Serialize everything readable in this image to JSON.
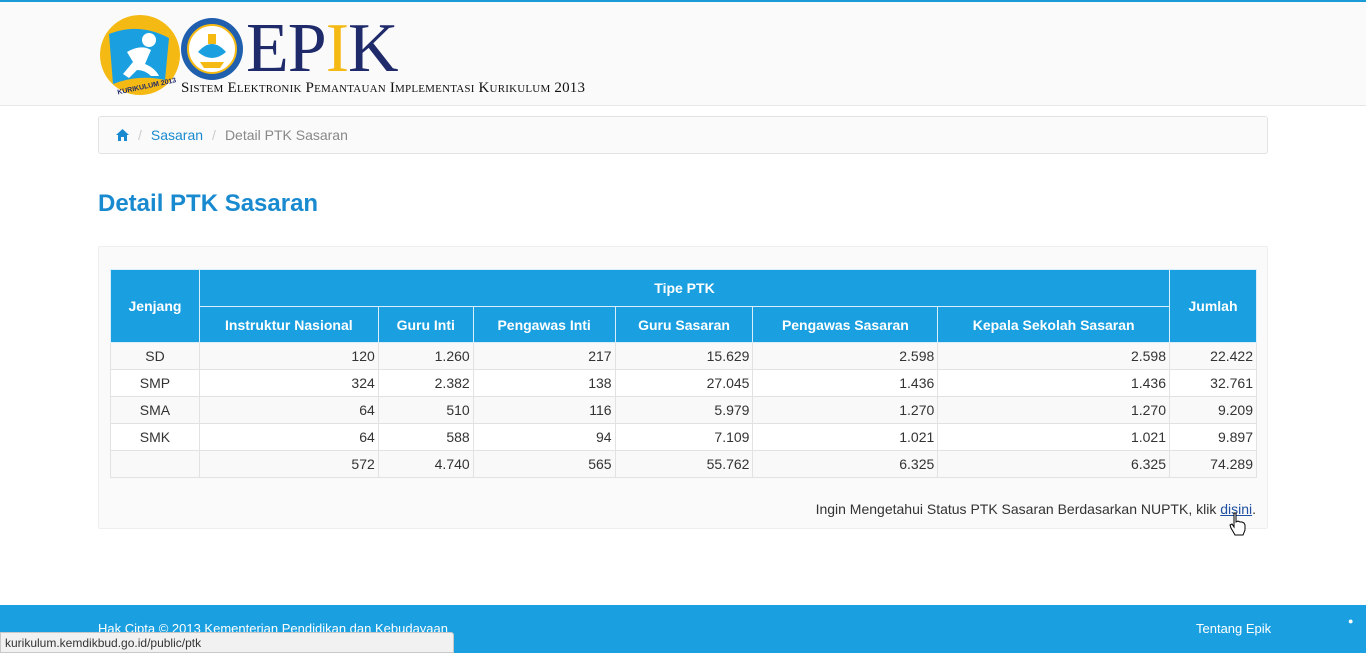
{
  "header": {
    "logo_text_a": "EP",
    "logo_text_i": "I",
    "logo_text_b": "K",
    "subtitle": "Sistem Elektronik Pemantauan Implementasi Kurikulum 2013",
    "badge_text": "KURIKULUM 2013"
  },
  "breadcrumb": {
    "home_icon": "home-icon",
    "items": [
      "Sasaran",
      "Detail PTK Sasaran"
    ]
  },
  "page_title": "Detail PTK Sasaran",
  "table": {
    "header_group": "Tipe PTK",
    "col_jenjang": "Jenjang",
    "col_jumlah": "Jumlah",
    "sub_columns": [
      "Instruktur Nasional",
      "Guru Inti",
      "Pengawas Inti",
      "Guru Sasaran",
      "Pengawas Sasaran",
      "Kepala Sekolah Sasaran"
    ],
    "rows": [
      {
        "jenjang": "SD",
        "values": [
          "120",
          "1.260",
          "217",
          "15.629",
          "2.598",
          "2.598",
          "22.422"
        ]
      },
      {
        "jenjang": "SMP",
        "values": [
          "324",
          "2.382",
          "138",
          "27.045",
          "1.436",
          "1.436",
          "32.761"
        ]
      },
      {
        "jenjang": "SMA",
        "values": [
          "64",
          "510",
          "116",
          "5.979",
          "1.270",
          "1.270",
          "9.209"
        ]
      },
      {
        "jenjang": "SMK",
        "values": [
          "64",
          "588",
          "94",
          "7.109",
          "1.021",
          "1.021",
          "9.897"
        ]
      },
      {
        "jenjang": "",
        "values": [
          "572",
          "4.740",
          "565",
          "55.762",
          "6.325",
          "6.325",
          "74.289"
        ]
      }
    ]
  },
  "note": {
    "text": "Ingin Mengetahui Status PTK Sasaran Berdasarkan NUPTK, klik ",
    "link": "disini",
    "end": "."
  },
  "footer": {
    "copyright": "Hak Cipta © 2013 Kementerian Pendidikan dan Kebudayaan",
    "about": "Tentang Epik"
  },
  "statusbar": "kurikulum.kemdikbud.go.id/public/ptk",
  "colors": {
    "accent": "#1aa0e0",
    "link": "#1a8ad0",
    "logo_navy": "#1f2a6b",
    "logo_yellow": "#f5b914"
  }
}
